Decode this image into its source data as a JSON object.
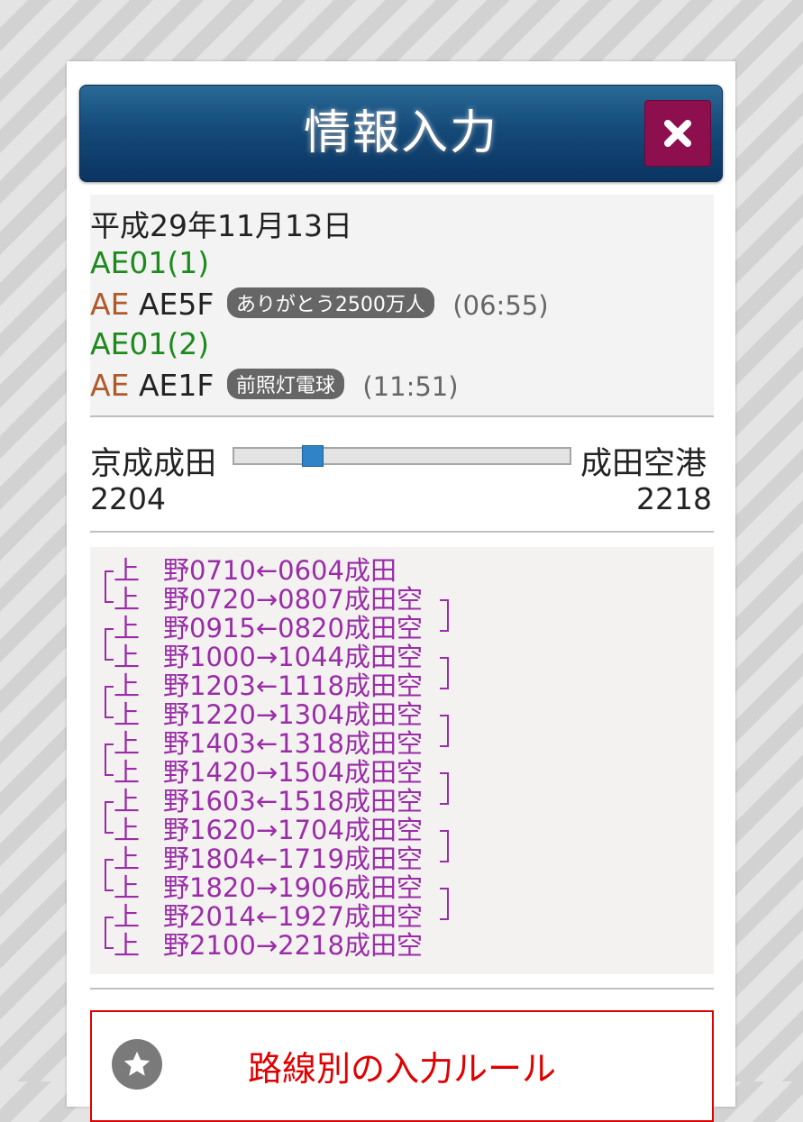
{
  "header": {
    "title": "情報入力"
  },
  "info": {
    "date": "平成29年11月13日",
    "entries": [
      {
        "id": "AE01(1)",
        "prefix": "AE",
        "car": "AE5F",
        "note": "ありがとう2500万人",
        "time": "(06:55)"
      },
      {
        "id": "AE01(2)",
        "prefix": "AE",
        "car": "AE1F",
        "note": "前照灯電球",
        "time": "(11:51)"
      }
    ]
  },
  "route": {
    "from_station": "京成成田",
    "to_station": "成田空港",
    "from_number": "2204",
    "to_number": "2218",
    "slider_position": 0.22
  },
  "schedule": [
    {
      "a": "上",
      "b": "野",
      "c": "0710",
      "arrow": "←",
      "d": "0604",
      "e": "成",
      "f": "田"
    },
    {
      "a": "上",
      "b": "野",
      "c": "0720",
      "arrow": "→",
      "d": "0807",
      "e": "成",
      "f": "田空"
    },
    {
      "a": "上",
      "b": "野",
      "c": "0915",
      "arrow": "←",
      "d": "0820",
      "e": "成",
      "f": "田空"
    },
    {
      "a": "上",
      "b": "野",
      "c": "1000",
      "arrow": "→",
      "d": "1044",
      "e": "成",
      "f": "田空"
    },
    {
      "a": "上",
      "b": "野",
      "c": "1203",
      "arrow": "←",
      "d": "1118",
      "e": "成",
      "f": "田空"
    },
    {
      "a": "上",
      "b": "野",
      "c": "1220",
      "arrow": "→",
      "d": "1304",
      "e": "成",
      "f": "田空"
    },
    {
      "a": "上",
      "b": "野",
      "c": "1403",
      "arrow": "←",
      "d": "1318",
      "e": "成",
      "f": "田空"
    },
    {
      "a": "上",
      "b": "野",
      "c": "1420",
      "arrow": "→",
      "d": "1504",
      "e": "成",
      "f": "田空"
    },
    {
      "a": "上",
      "b": "野",
      "c": "1603",
      "arrow": "←",
      "d": "1518",
      "e": "成",
      "f": "田空"
    },
    {
      "a": "上",
      "b": "野",
      "c": "1620",
      "arrow": "→",
      "d": "1704",
      "e": "成",
      "f": "田空"
    },
    {
      "a": "上",
      "b": "野",
      "c": "1804",
      "arrow": "←",
      "d": "1719",
      "e": "成",
      "f": "田空"
    },
    {
      "a": "上",
      "b": "野",
      "c": "1820",
      "arrow": "→",
      "d": "1906",
      "e": "成",
      "f": "田空"
    },
    {
      "a": "上",
      "b": "野",
      "c": "2014",
      "arrow": "←",
      "d": "1927",
      "e": "成",
      "f": "田空"
    },
    {
      "a": "上",
      "b": "野",
      "c": "2100",
      "arrow": "→",
      "d": "2218",
      "e": "成",
      "f": "田空"
    }
  ],
  "rules_button": {
    "label": "路線別の入力ルール",
    "icon": "star-icon"
  },
  "colors": {
    "header": "#144a79",
    "close": "#8e0f4e",
    "green": "#1d8a1d",
    "schedule": "#9a2ca8",
    "rules": "#e00000"
  }
}
